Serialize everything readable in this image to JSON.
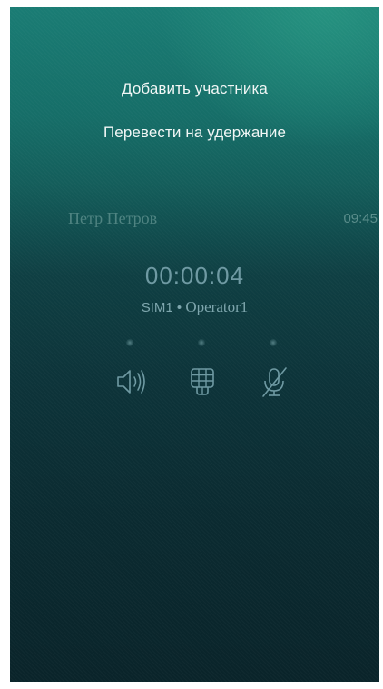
{
  "menu": {
    "add_participant": "Добавить участника",
    "hold": "Перевести на удержание"
  },
  "call": {
    "caller_name": "Петр Петров",
    "time": "09:45",
    "duration": "00:00:04",
    "sim": "SIM1",
    "separator": "•",
    "operator": "Operator1"
  },
  "controls": [
    {
      "name": "speaker",
      "icon": "speaker-icon"
    },
    {
      "name": "keypad",
      "icon": "keypad-icon"
    },
    {
      "name": "mute",
      "icon": "mic-muted-icon"
    }
  ],
  "colors": {
    "background_top": "#1a7c74",
    "background_bottom": "#0a242a",
    "menu_text": "#f2f7f6",
    "dim_text": "#6f9aa3"
  }
}
